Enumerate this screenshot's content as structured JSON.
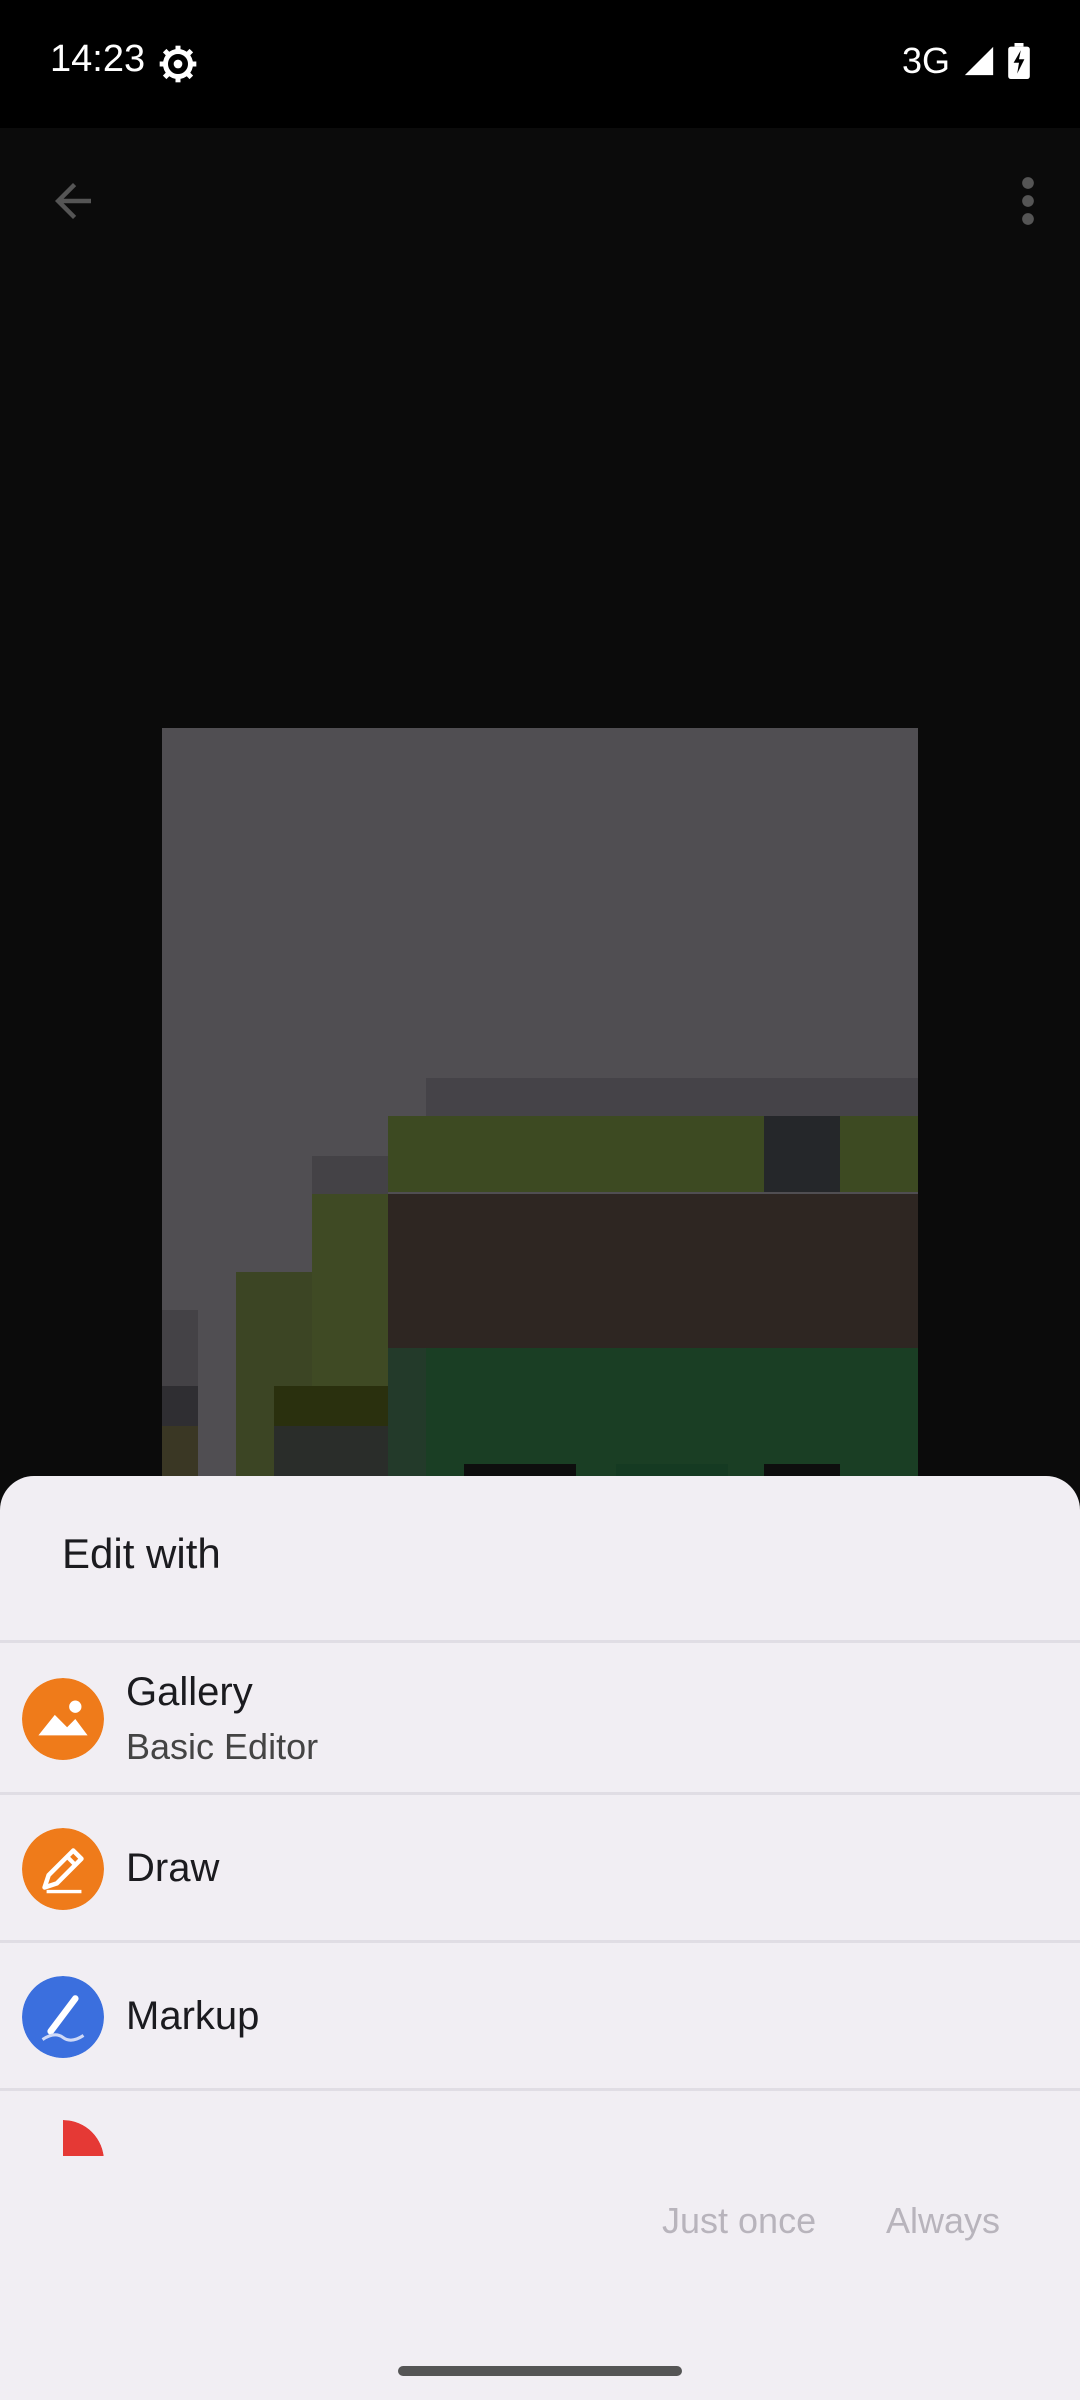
{
  "status_bar": {
    "time": "14:23",
    "network": "3G"
  },
  "viewer": {
    "back_icon": "arrow-back-icon",
    "more_icon": "more-vert-icon"
  },
  "sheet": {
    "title": "Edit with",
    "apps": [
      {
        "name": "Gallery",
        "subtitle": "Basic Editor",
        "icon": "gallery-mountain-icon",
        "color": "#ef7b1a"
      },
      {
        "name": "Draw",
        "icon": "pencil-icon",
        "color": "#ef7b1a"
      },
      {
        "name": "Markup",
        "icon": "markup-pen-icon",
        "color": "#3b6fde"
      },
      {
        "name": "",
        "icon": "partial-app-icon",
        "color": "#e53935"
      }
    ],
    "actions": {
      "just_once": "Just once",
      "always": "Always"
    }
  }
}
